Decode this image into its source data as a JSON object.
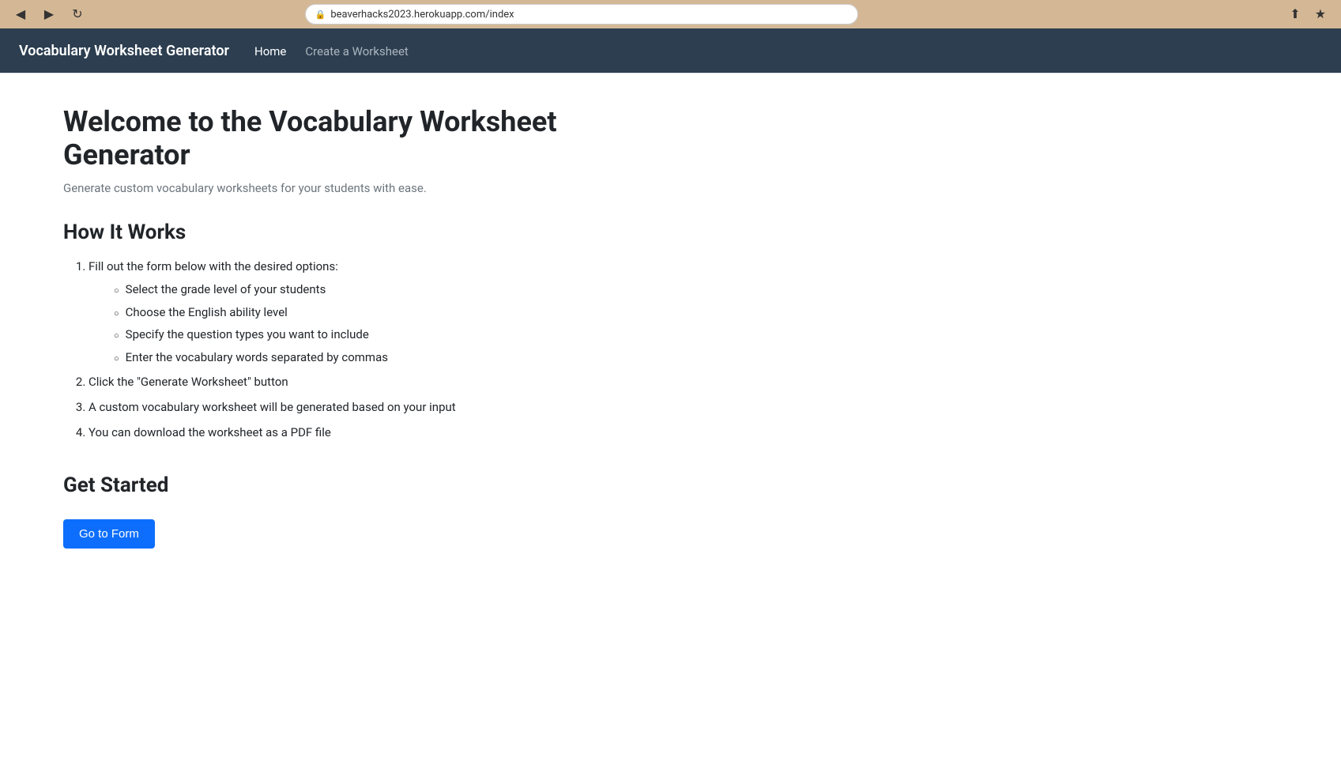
{
  "browser": {
    "url": "beaverhacks2023.herokuapp.com/index",
    "back_icon": "◀",
    "forward_icon": "▶",
    "refresh_icon": "↻",
    "share_icon": "⎋",
    "star_icon": "☆"
  },
  "navbar": {
    "brand": "Vocabulary Worksheet Generator",
    "nav_items": [
      {
        "label": "Home",
        "muted": false
      },
      {
        "label": "Create a Worksheet",
        "muted": true
      }
    ]
  },
  "main": {
    "page_title": "Welcome to the Vocabulary Worksheet Generator",
    "subtitle": "Generate custom vocabulary worksheets for your students with ease.",
    "how_it_works": {
      "section_title": "How It Works",
      "steps": [
        {
          "text": "Fill out the form below with the desired options:",
          "sub_items": [
            "Select the grade level of your students",
            "Choose the English ability level",
            "Specify the question types you want to include",
            "Enter the vocabulary words separated by commas"
          ]
        },
        {
          "text": "Click the \"Generate Worksheet\" button",
          "sub_items": []
        },
        {
          "text": "A custom vocabulary worksheet will be generated based on your input",
          "sub_items": []
        },
        {
          "text": "You can download the worksheet as a PDF file",
          "sub_items": []
        }
      ]
    },
    "get_started": {
      "section_title": "Get Started",
      "button_label": "Go to Form"
    }
  }
}
